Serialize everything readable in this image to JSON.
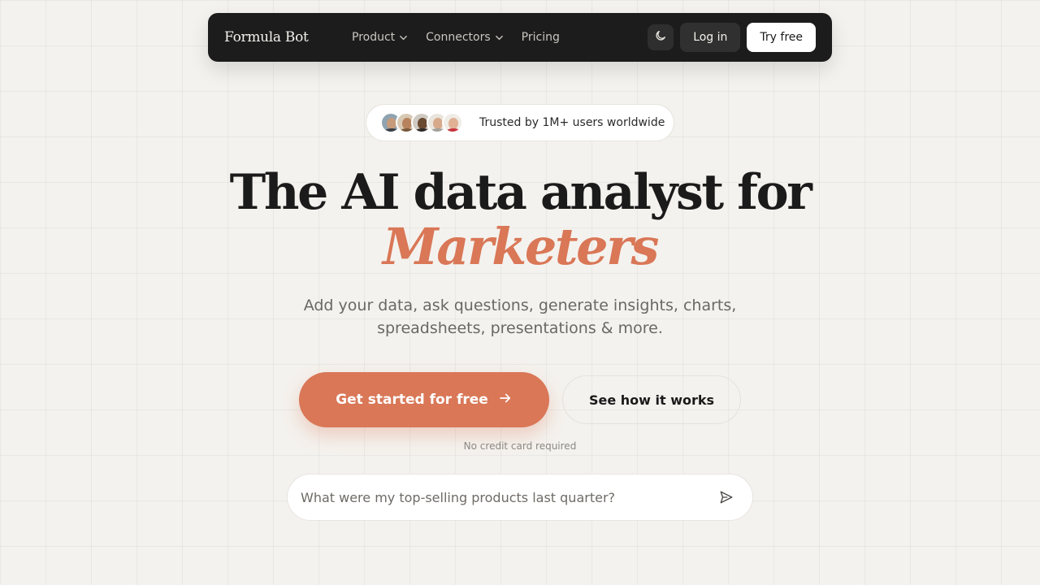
{
  "nav": {
    "logo": "Formula Bot",
    "links": [
      {
        "label": "Product",
        "has_dropdown": true
      },
      {
        "label": "Connectors",
        "has_dropdown": true
      },
      {
        "label": "Pricing",
        "has_dropdown": false
      }
    ],
    "theme_icon": "moon-icon",
    "login_label": "Log in",
    "try_label": "Try free"
  },
  "trust": {
    "text": "Trusted by 1M+ users worldwide",
    "avatar_count": 5
  },
  "hero": {
    "headline_line1": "The AI data analyst for",
    "headline_accent": "Marketers",
    "subtitle": "Add your data, ask questions, generate insights, charts, spreadsheets, presentations & more."
  },
  "cta": {
    "primary_label": "Get started for free",
    "primary_icon": "arrow-right-icon",
    "secondary_label": "See how it works",
    "note": "No credit card required"
  },
  "prompt": {
    "placeholder": "What were my top-selling products last quarter?",
    "send_icon": "send-icon"
  },
  "colors": {
    "accent": "#d97757",
    "nav_bg": "#1c1c1c",
    "page_bg": "#f4f2ee"
  }
}
